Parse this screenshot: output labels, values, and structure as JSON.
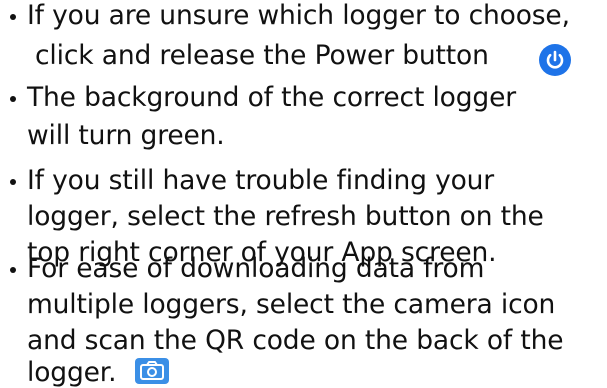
{
  "instructions": [
    {
      "lines": [
        "If you are unsure which logger to choose,",
        "click and release the Power button"
      ]
    },
    {
      "lines": [
        "The background of the correct logger",
        "will turn green."
      ]
    },
    {
      "lines": [
        "If you still have trouble finding your",
        "logger, select the refresh button on the",
        "top right corner of your App screen."
      ]
    },
    {
      "lines": [
        "For ease of downloading data from",
        "multiple loggers, select the camera icon",
        "and scan the QR code on the back of the",
        "logger."
      ]
    }
  ],
  "icons": {
    "power": "power-icon",
    "camera": "camera-icon"
  },
  "colors": {
    "power_icon": "#1e73e8",
    "camera_icon": "#3b8fe6",
    "text": "#111111"
  }
}
